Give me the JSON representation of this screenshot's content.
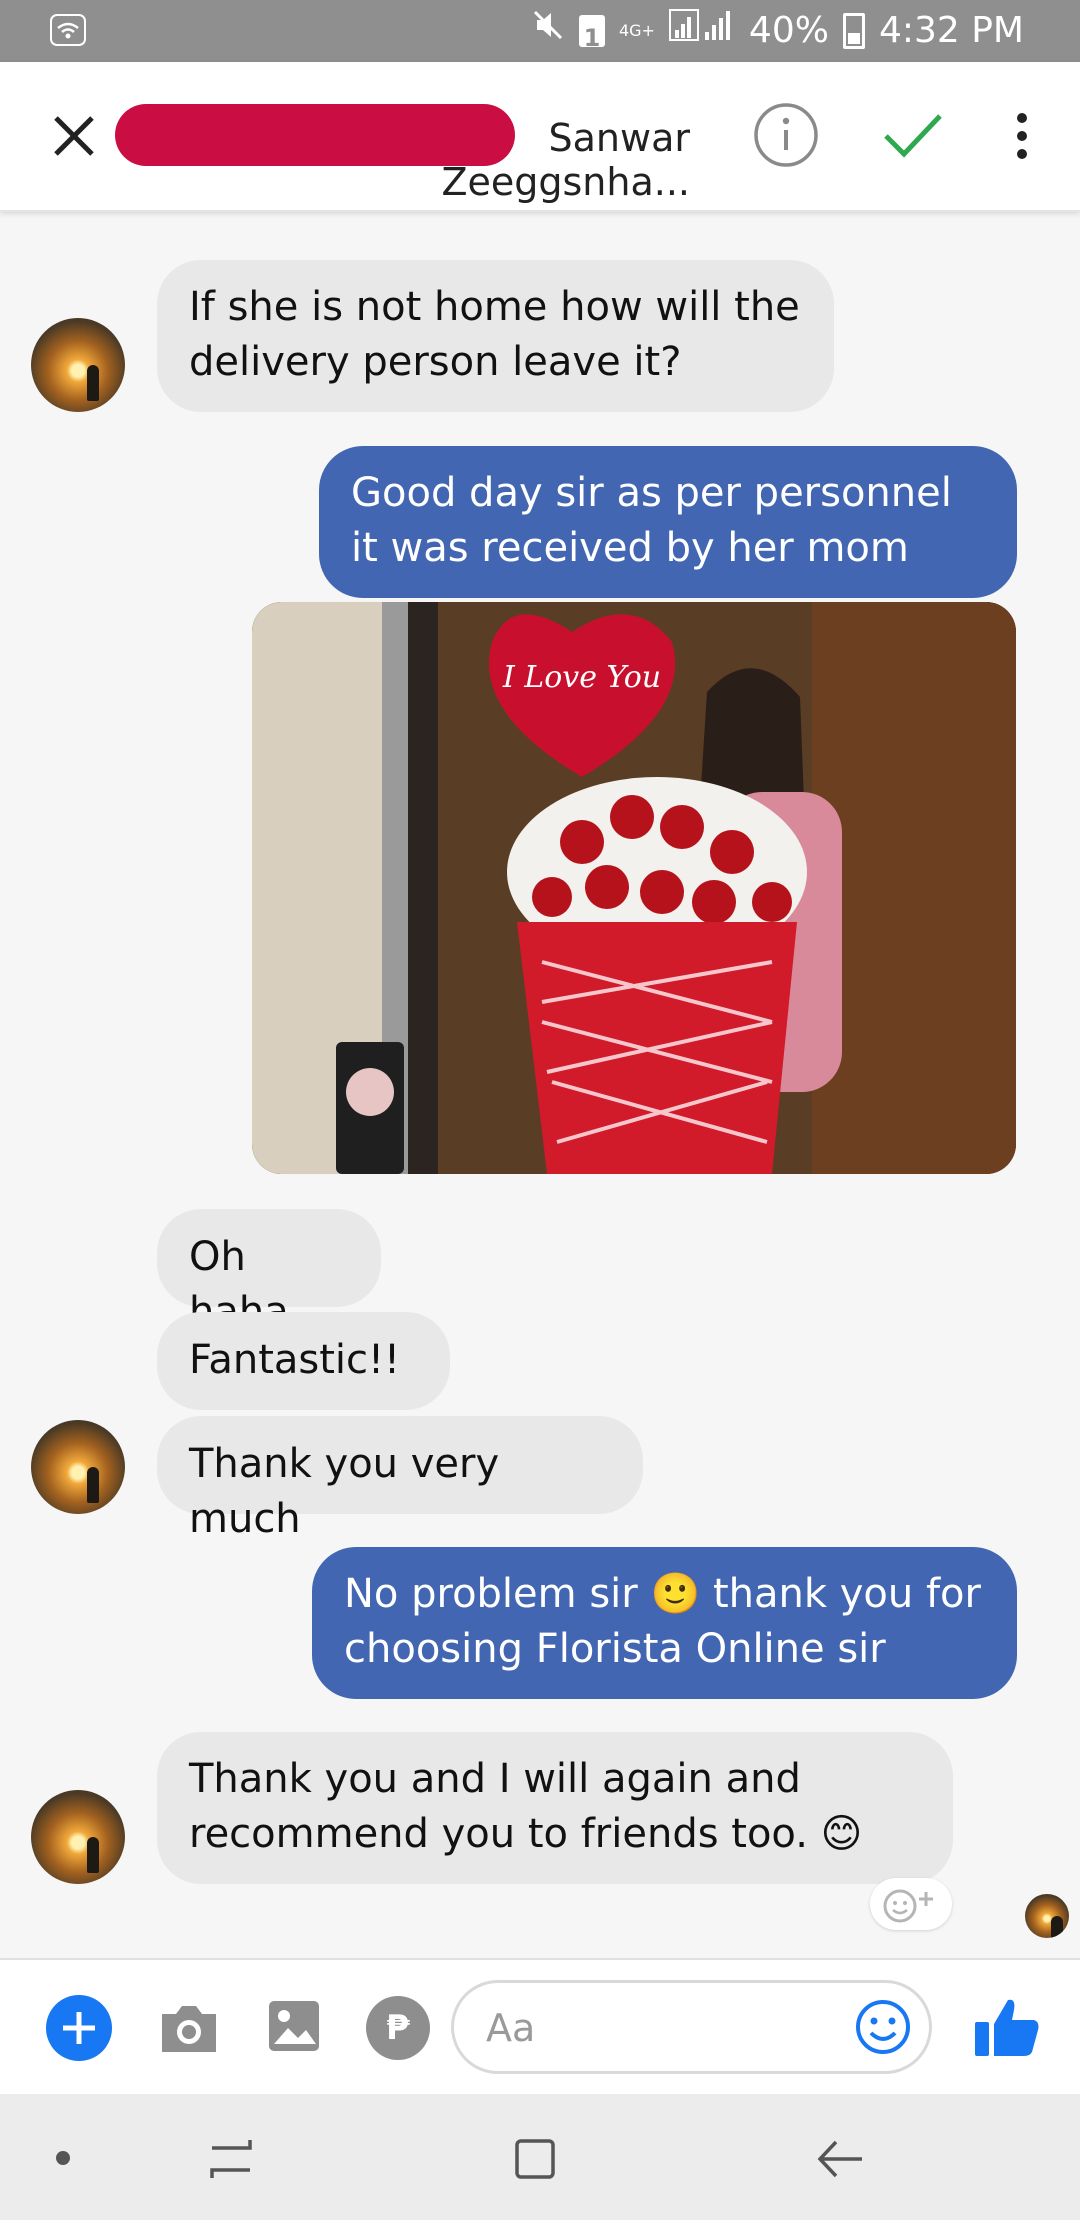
{
  "status_bar": {
    "network_label": "4G+",
    "sim_badge": "1",
    "battery": "40%",
    "time": "4:32 PM"
  },
  "header": {
    "contact_name_visible": "Sanwar Zeeggsnha..."
  },
  "messages": [
    {
      "direction": "incoming",
      "text": "If she is not home how will the delivery person leave it?"
    },
    {
      "direction": "outgoing",
      "text": "Good day sir as per personnel it was received by her mom"
    },
    {
      "direction": "outgoing",
      "type": "photo",
      "photo_text": "I Love You"
    },
    {
      "direction": "incoming",
      "text": "Oh haha"
    },
    {
      "direction": "incoming",
      "text": "Fantastic!!"
    },
    {
      "direction": "incoming",
      "text": "Thank you very much"
    },
    {
      "direction": "outgoing",
      "text": "No problem sir 🙂 thank you for choosing Florista Online sir"
    },
    {
      "direction": "incoming",
      "text": "Thank you and I will again and recommend you to friends too. 😊"
    }
  ],
  "composer": {
    "placeholder": "Aa",
    "payment_symbol": "₱"
  },
  "colors": {
    "outgoing_bubble": "#4266b2",
    "incoming_bubble": "#e8e8e9",
    "accent_blue": "#1877f2",
    "check_green": "#2fa84f",
    "redaction_red": "#c70039"
  }
}
